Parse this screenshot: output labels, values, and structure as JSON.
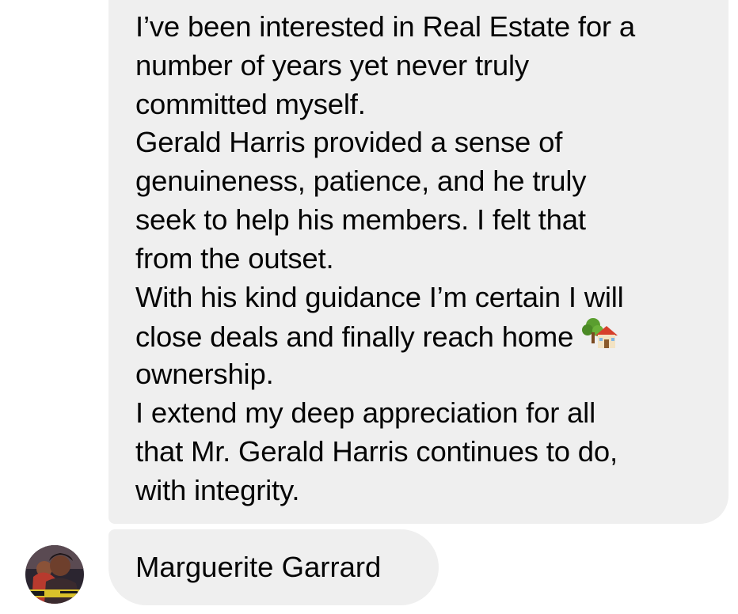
{
  "message": {
    "lines": [
      "I’ve been interested in Real Estate for a",
      "number of years yet never truly",
      "committed myself.",
      "Gerald Harris provided a sense of",
      "genuineness, patience, and he truly",
      "seek to help his members.  I felt that",
      "from the outset.",
      "With his kind guidance I’m certain I will",
      "close deals and finally reach home",
      "ownership.",
      "I extend my deep appreciation for all",
      "that Mr.  Gerald Harris continues to do,",
      "with integrity."
    ],
    "emoji": "house-with-garden-icon"
  },
  "author": {
    "name": "Marguerite Garrard",
    "avatar": "profile-photo-avatar"
  },
  "colors": {
    "bubble": "#efefef",
    "text": "#050505",
    "background": "#ffffff"
  }
}
